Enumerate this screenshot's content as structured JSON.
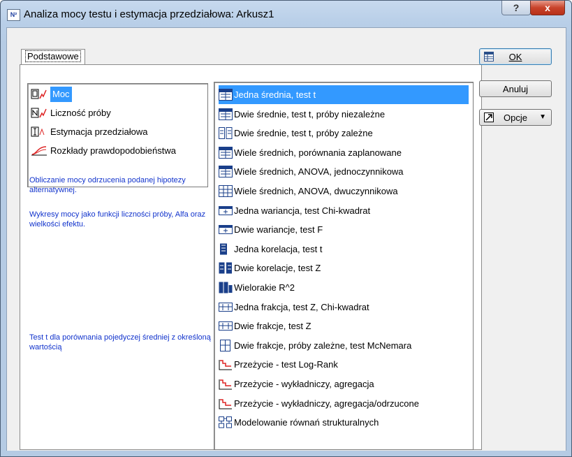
{
  "window": {
    "title": "Analiza mocy testu i estymacja przedziałowa: Arkusz1",
    "app_icon_text": "N²",
    "help_label": "?",
    "close_label": "x"
  },
  "tab": {
    "label": "Podstawowe"
  },
  "buttons": {
    "ok": "OK",
    "cancel": "Anuluj",
    "options": "Opcje",
    "options_arrow": "▼"
  },
  "left_list": [
    {
      "label": "Moc",
      "icon": "power-icon",
      "selected": true
    },
    {
      "label": "Liczność próby",
      "icon": "sample-size-icon",
      "selected": false
    },
    {
      "label": "Estymacja przedziałowa",
      "icon": "interval-icon",
      "selected": false
    },
    {
      "label": "Rozkłady prawdopodobieństwa",
      "icon": "distribution-icon",
      "selected": false
    }
  ],
  "description": {
    "line1": "Obliczanie mocy odrzucenia podanej hipotezy alternatywnej.",
    "line2": "Wykresy mocy jako funkcji liczności próby, Alfa oraz wielkości efektu.",
    "line3": "Test t dla porównania pojedyczej średniej z określoną wartością"
  },
  "right_list": [
    {
      "label": "Jedna średnia, test t",
      "icon": "ttest-icon",
      "selected": true
    },
    {
      "label": "Dwie średnie, test t, próby niezależne",
      "icon": "ttest-icon",
      "selected": false
    },
    {
      "label": "Dwie średnie, test t, próby zależne",
      "icon": "paired-icon",
      "selected": false
    },
    {
      "label": "Wiele średnich, porównania zaplanowane",
      "icon": "ttest-icon",
      "selected": false
    },
    {
      "label": "Wiele średnich, ANOVA, jednoczynnikowa",
      "icon": "ttest-icon",
      "selected": false
    },
    {
      "label": "Wiele średnich, ANOVA, dwuczynnikowa",
      "icon": "anova2-icon",
      "selected": false
    },
    {
      "label": "Jedna wariancja, test Chi-kwadrat",
      "icon": "variance-icon",
      "selected": false
    },
    {
      "label": "Dwie wariancje, test F",
      "icon": "variance-icon",
      "selected": false
    },
    {
      "label": "Jedna korelacja, test t",
      "icon": "correlation-icon",
      "selected": false
    },
    {
      "label": "Dwie korelacje, test Z",
      "icon": "correlation2-icon",
      "selected": false
    },
    {
      "label": "Wielorakie R^2",
      "icon": "multiple-r-icon",
      "selected": false
    },
    {
      "label": "Jedna frakcja, test Z, Chi-kwadrat",
      "icon": "fraction-icon",
      "selected": false
    },
    {
      "label": "Dwie frakcje, test Z",
      "icon": "fraction-icon",
      "selected": false
    },
    {
      "label": "Dwie frakcje, próby zależne, test McNemara",
      "icon": "mcnemar-icon",
      "selected": false
    },
    {
      "label": "Przeżycie - test Log-Rank",
      "icon": "survival-icon",
      "selected": false
    },
    {
      "label": "Przeżycie - wykładniczy, agregacja",
      "icon": "survival-icon",
      "selected": false
    },
    {
      "label": "Przeżycie - wykładniczy, agregacja/odrzucone",
      "icon": "survival-icon",
      "selected": false
    },
    {
      "label": "Modelowanie równań strukturalnych",
      "icon": "sem-icon",
      "selected": false
    }
  ],
  "colors": {
    "selection": "#3399ff",
    "description_text": "#1133cc",
    "close": "#c8432b"
  }
}
